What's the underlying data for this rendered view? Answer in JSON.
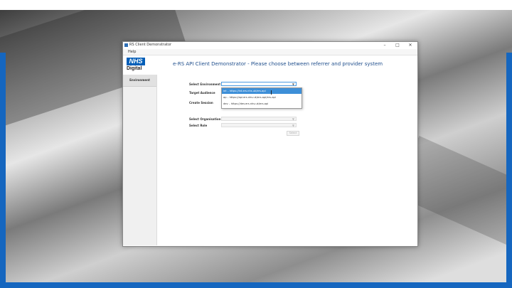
{
  "window": {
    "title": "RS Client Demonstrator",
    "controls": {
      "minimize": "–",
      "maximize": "□",
      "close": "✕"
    }
  },
  "menu": {
    "help": "Help"
  },
  "logo": {
    "nhs": "NHS",
    "digital": "Digital"
  },
  "heading": "e-RS API Client Demonstrator - Please choose between referrer and provider system",
  "sidebar": {
    "items": [
      {
        "label": "Environment"
      }
    ]
  },
  "form": {
    "environment_label": "Select Environment",
    "target_audience_label": "Target Audience",
    "create_session_label": "Create Session",
    "organisation_label": "Select Organisation",
    "role_label": "Select Role",
    "select_button": "Select"
  },
  "dropdown_options": [
    "int – https://int.ers.nhs.uk/ers-api",
    "ap – https://api.ers.nhs.uk/ers-api/ers-api",
    "dev – https://dev.ers.nhs.uk/ers-api"
  ],
  "icons": {
    "app": "app-icon",
    "arrow": "chevron-down-icon"
  },
  "colors": {
    "nhs_blue": "#005eb8",
    "heading": "#1f4e8c",
    "selected": "#3d8fd8",
    "frame_blue": "#1566bf"
  }
}
